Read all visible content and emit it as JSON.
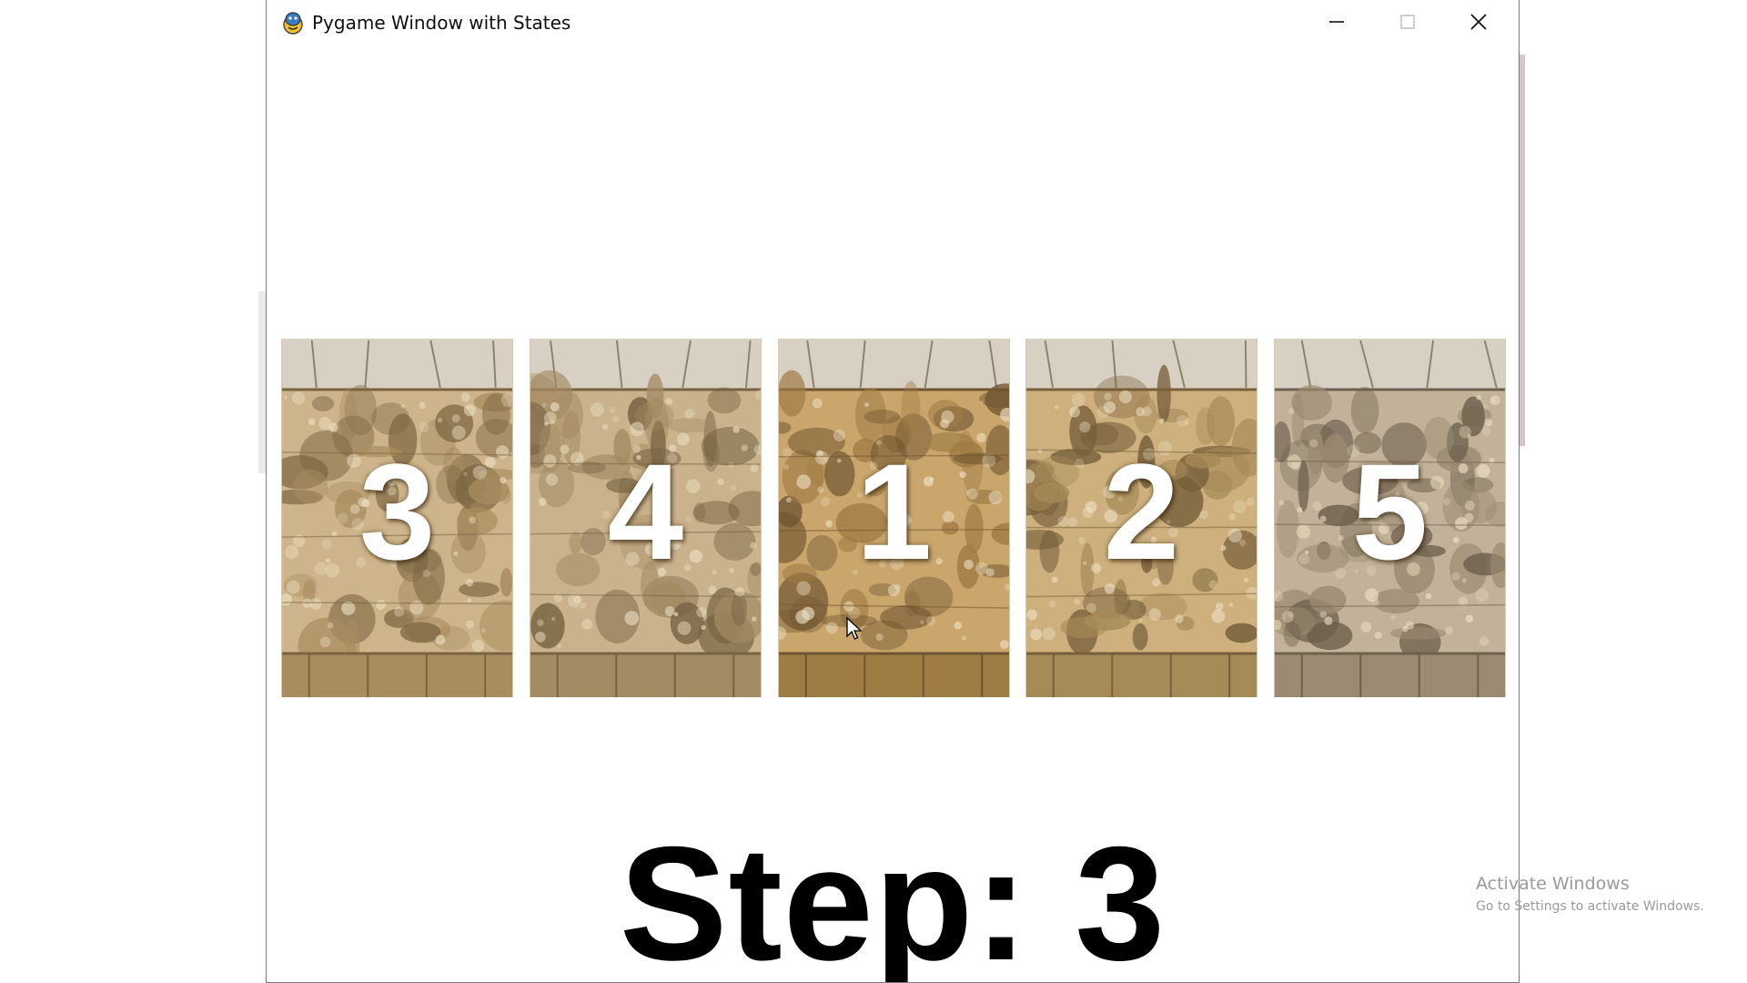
{
  "window": {
    "title": "Pygame Window with States",
    "controls": {
      "minimize": "minimize",
      "maximize": "maximize",
      "close": "close"
    }
  },
  "tiles": [
    {
      "number": "3",
      "palette": [
        "#cdb48a",
        "#a88d5f",
        "#7a6440"
      ]
    },
    {
      "number": "4",
      "palette": [
        "#c9b28c",
        "#a38b63",
        "#776243"
      ]
    },
    {
      "number": "1",
      "palette": [
        "#caa56c",
        "#a07c45",
        "#6f5430"
      ]
    },
    {
      "number": "2",
      "palette": [
        "#cdb07e",
        "#a68a58",
        "#765f3a"
      ]
    },
    {
      "number": "5",
      "palette": [
        "#c2b29a",
        "#9b8b72",
        "#6d604d"
      ]
    }
  ],
  "step": {
    "text": "Step: 3"
  },
  "watermark": {
    "title": "Activate Windows",
    "subtitle": "Go to Settings to activate Windows."
  }
}
